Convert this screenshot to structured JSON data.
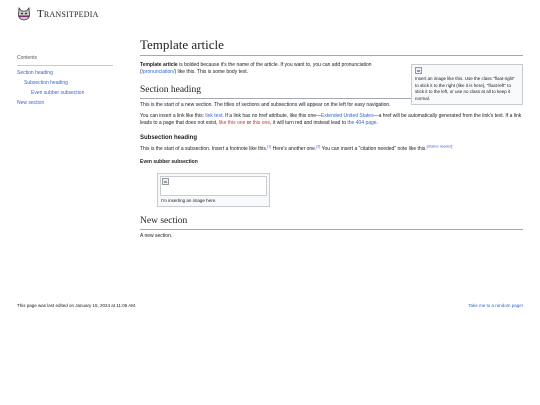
{
  "site": {
    "name": "Transitpedia",
    "logo_icon": "cat-icon"
  },
  "toc": {
    "title": "Contents",
    "items": [
      {
        "label": "Section heading",
        "level": 1
      },
      {
        "label": "Subsection heading",
        "level": 2
      },
      {
        "label": "Even subber subsection",
        "level": 3
      },
      {
        "label": "New section",
        "level": 1
      }
    ]
  },
  "article": {
    "title": "Template article",
    "intro": {
      "bold": "Template article",
      "text1": " is bolded because it's the name of the article. If you want to, you can add pronunciation (",
      "pron": "/pronunciation/",
      "text2": ") like this. This is some body text."
    },
    "float_box": {
      "text": "Insert an image like this. Use the class \"float-right\" to stick it to the right (like it is here), \"float-left\" to stick it to the left, or use no class at all to keep it normal."
    },
    "section1": {
      "heading": "Section heading",
      "p1": "This is the start of a new section. The titles of sections and subsections will appear on the left for easy navigation.",
      "p2_a": "You can insert a link like this: ",
      "link_text": "link text",
      "p2_b": ". If a link has no href attribute, like this one—",
      "extended_link": "Extended United States",
      "p2_c": "—a href will be automatically generated from the link's text. If a link leads to a page that does not exist, ",
      "red1": "like this one",
      "p2_d": " or ",
      "red2": "this one",
      "p2_e": ", it will turn red and instead lead to ",
      "link404": "the 404 page",
      "p2_f": "."
    },
    "subsection": {
      "heading": "Subsection heading",
      "p_a": "This is the start of a subsection. Insert a footnote like this.",
      "fn1": "[1]",
      "p_b": " Here's another one.",
      "fn2": "[2]",
      "p_c": " You can insert a \"citation needed\" note like this.",
      "citation": "[citation needed]"
    },
    "subsubsection": {
      "heading": "Even subber subsection",
      "caption": "I'm inserting an image here."
    },
    "new_section": {
      "heading": "New section",
      "text": "A new section."
    }
  },
  "footer": {
    "last_edited": "This page was last edited on January 15, 2024 at 11:06 AM.",
    "random_link": "Take me to a random page!"
  }
}
